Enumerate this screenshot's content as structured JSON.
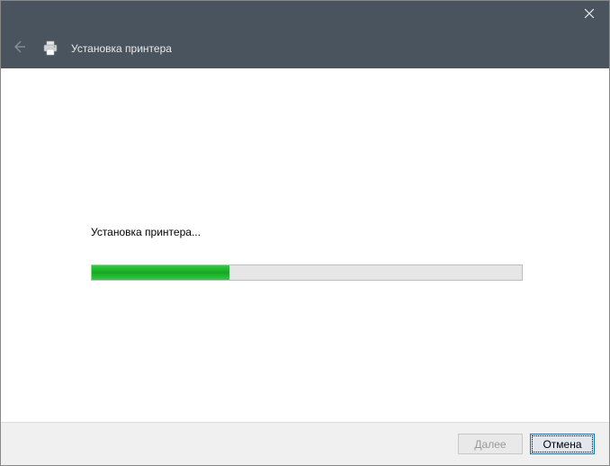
{
  "titlebar": {
    "close_tooltip": "Close"
  },
  "header": {
    "title": "Установка принтера"
  },
  "main": {
    "status_text": "Установка принтера...",
    "progress_percent": 32
  },
  "footer": {
    "next_label": "Далее",
    "cancel_label": "Отмена"
  }
}
